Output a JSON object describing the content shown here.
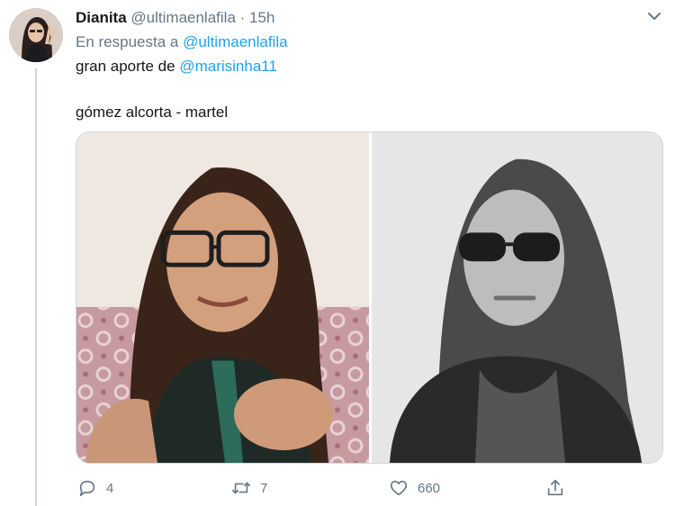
{
  "tweet": {
    "author_name": "Dianita",
    "author_handle": "@ultimaenlafila",
    "separator": "·",
    "time": "15h",
    "reply_prefix": "En respuesta a",
    "reply_handle": "@ultimaenlafila",
    "text_prefix": "gran aporte de",
    "mention": "@marisinha11",
    "text_second": "gómez alcorta - martel"
  },
  "media": {
    "photos": [
      {
        "icon": "photo-woman-glasses-color"
      },
      {
        "icon": "photo-woman-sunglasses-bw"
      }
    ]
  },
  "actions": {
    "reply_count": "4",
    "retweet_count": "7",
    "like_count": "660",
    "icons": [
      "reply-icon",
      "retweet-icon",
      "like-icon",
      "share-icon"
    ]
  },
  "colors": {
    "link": "#1da1f2",
    "secondary_text": "#657786",
    "primary_text": "#14171a",
    "border": "#ccd6dd"
  }
}
